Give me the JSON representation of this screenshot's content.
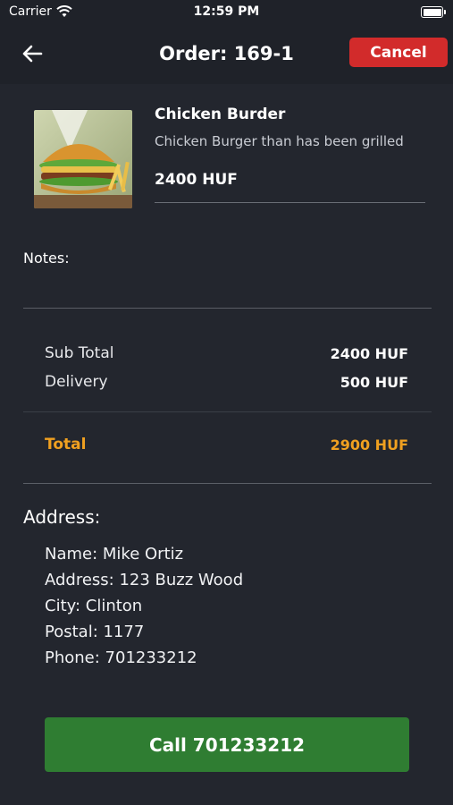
{
  "status_bar": {
    "carrier": "Carrier",
    "time": "12:59 PM"
  },
  "nav": {
    "title": "Order:  169-1",
    "cancel_label": "Cancel"
  },
  "item": {
    "name": "Chicken Burder",
    "description": "Chicken Burger than has been grilled",
    "price": "2400 HUF"
  },
  "notes": {
    "label": "Notes:"
  },
  "summary": {
    "subtotal_label": "Sub Total",
    "subtotal_value": "2400 HUF",
    "delivery_label": "Delivery",
    "delivery_value": "500 HUF",
    "total_label": "Total",
    "total_value": "2900 HUF"
  },
  "address": {
    "heading": "Address:",
    "name": "Name: Mike Ortiz",
    "street": "Address: 123 Buzz Wood",
    "city": "City: Clinton",
    "postal": "Postal: 1177",
    "phone": "Phone: 701233212"
  },
  "call_button": {
    "label": "Call 701233212"
  },
  "colors": {
    "background": "#23262e",
    "accent_total": "#f0a020",
    "cancel": "#d22b2b",
    "call": "#2f7d32"
  }
}
